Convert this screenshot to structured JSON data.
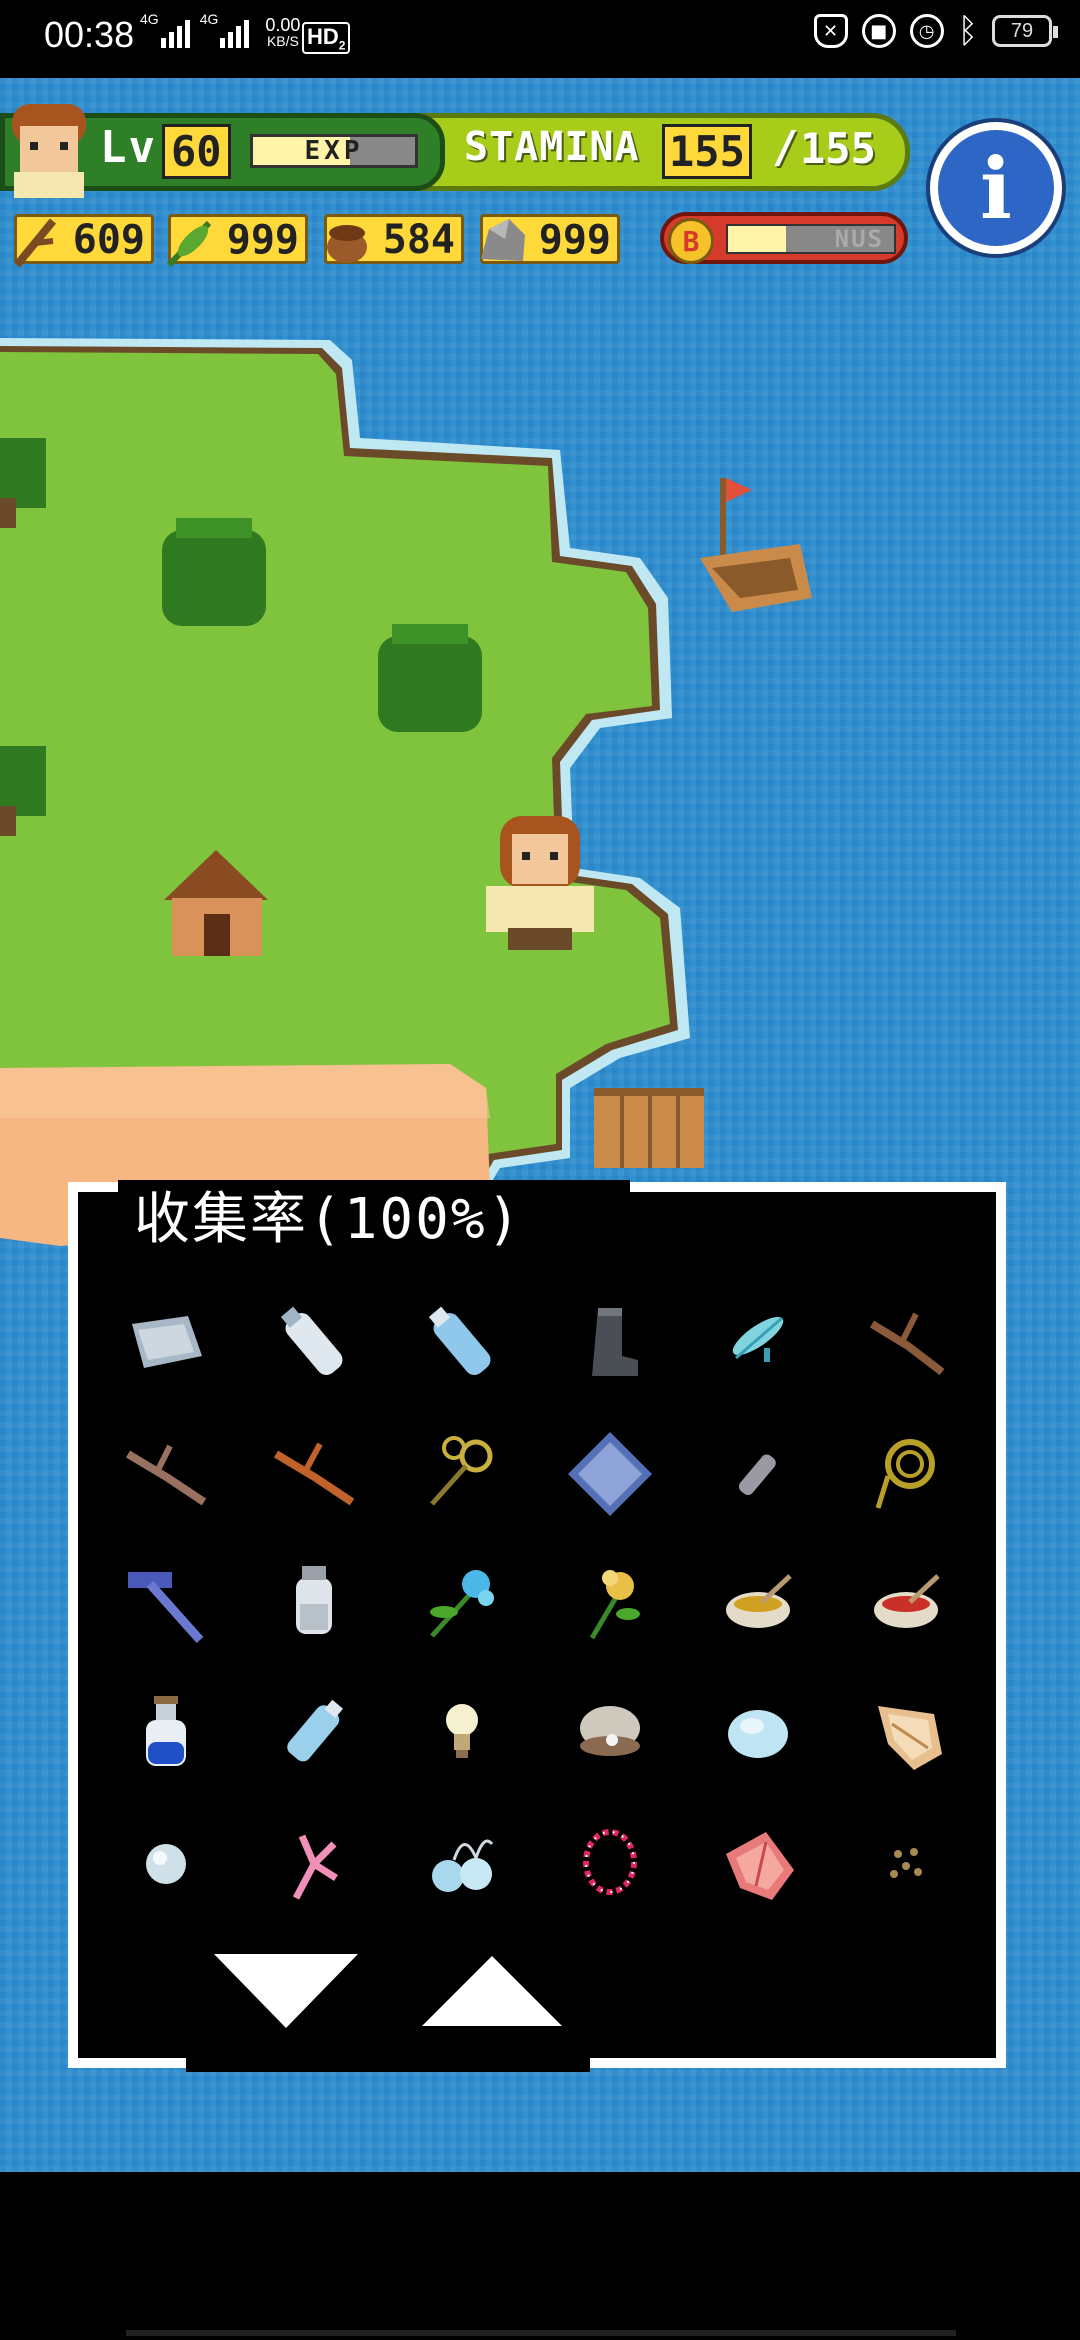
{
  "status_bar": {
    "time": "00:38",
    "network1": "4G",
    "network2": "4G",
    "speed_value": "0.00",
    "speed_unit": "KB/S",
    "hd_label": "HD",
    "hd_sub": "2",
    "battery": "79",
    "icons": [
      "bell-off-icon",
      "lock-rotation-icon",
      "alarm-icon",
      "bluetooth-icon"
    ]
  },
  "hud": {
    "level_label": "Lv",
    "level_value": "60",
    "exp_label": "EXP",
    "exp_fill": 0.6,
    "stamina_label": "STAMINA",
    "stamina_current": "155",
    "stamina_separator": "/",
    "stamina_max": "155",
    "info_icon": "i",
    "resources": [
      {
        "icon": "branch-icon",
        "value": "609"
      },
      {
        "icon": "leaf-icon",
        "value": "999"
      },
      {
        "icon": "nut-icon",
        "value": "584"
      },
      {
        "icon": "stone-icon",
        "value": "999"
      }
    ],
    "bonus_badge": "B",
    "bonus_label": "NUS",
    "bonus_fill": 0.35
  },
  "collection": {
    "title": "收集率(100%)",
    "items": [
      "cloth-icon",
      "bottle-icon",
      "water-bottle-icon",
      "boot-icon",
      "feather-icon",
      "branch-icon",
      "twig-icon",
      "orange-branch-icon",
      "racket-icon",
      "mirror-icon",
      "tube-icon",
      "rope-icon",
      "hammer-icon",
      "jar-icon",
      "blue-flower-icon",
      "yellow-flower-icon",
      "bowl-icon",
      "mortar-icon",
      "potion-icon",
      "glass-bottle-icon",
      "bulb-icon",
      "clam-icon",
      "egg-icon",
      "conch-icon",
      "pearl-icon",
      "coral-icon",
      "earrings-icon",
      "necklace-icon",
      "shell-icon",
      "seeds-icon"
    ],
    "scroll_down_icon": "arrow-down-icon",
    "scroll_up_icon": "arrow-up-icon"
  },
  "colors": {
    "sea": "#2f8fcf",
    "grass": "#7fc43c",
    "sand": "#f7b783",
    "hud_green": "#2e7f27",
    "stamina_bar": "#a8cc1a",
    "value_yellow": "#ffd93a"
  }
}
